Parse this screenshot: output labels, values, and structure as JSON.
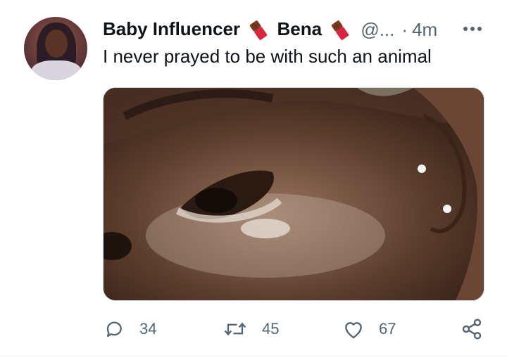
{
  "author": {
    "name_part1": "Baby Influencer",
    "name_part2": "Bena",
    "emoji_icon": "chocolate-bar-emoji",
    "handle": "@...",
    "separator": "·",
    "time": "4m"
  },
  "tweet_text": "I never prayed to be with such an animal",
  "media": {
    "description_icon": "photo"
  },
  "actions": {
    "reply_count": "34",
    "retweet_count": "45",
    "like_count": "67"
  },
  "colors": {
    "text": "#0f1419",
    "secondary": "#536471",
    "border": "#cfd9de",
    "emoji_red": "#e0245e",
    "emoji_brown": "#8b4a2b"
  }
}
